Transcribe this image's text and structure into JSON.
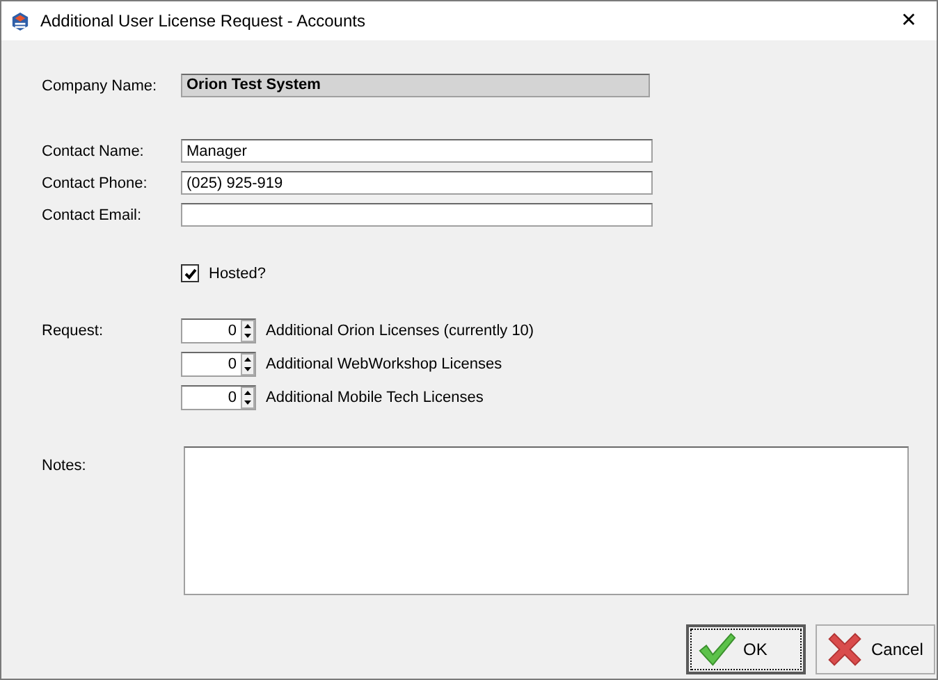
{
  "window": {
    "title": "Additional User License Request - Accounts",
    "close": "✕"
  },
  "company": {
    "label": "Company Name:",
    "value": "Orion Test System"
  },
  "contact_fields": [
    {
      "label": "Contact Name:",
      "value": "Manager"
    },
    {
      "label": "Contact Phone:",
      "value": "(025) 925-919"
    },
    {
      "label": "Contact Email:"
    }
  ],
  "hosted": {
    "label": "Hosted?",
    "checked": true
  },
  "request": {
    "label": "Request:",
    "items": [
      {
        "value": "0",
        "label": "Additional Orion Licenses (currently 10)"
      },
      {
        "value": "0",
        "label": "Additional WebWorkshop Licenses"
      },
      {
        "value": "0",
        "label": "Additional Mobile Tech Licenses"
      }
    ]
  },
  "notes": {
    "label": "Notes:"
  },
  "buttons": [
    {
      "kind": "ok",
      "label": "OK",
      "selected": true
    },
    {
      "kind": "cancel",
      "label": "Cancel",
      "selected": false
    }
  ]
}
